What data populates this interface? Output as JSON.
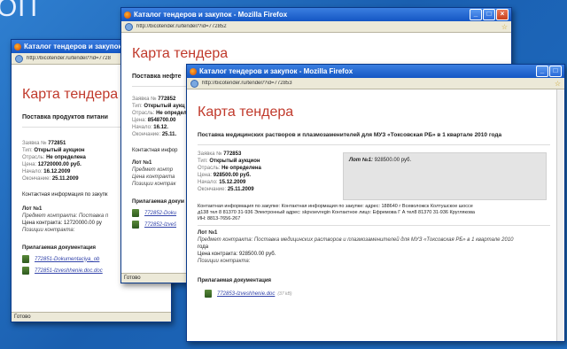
{
  "background_word": "ОП",
  "window_left": {
    "title": "Каталог тендеров и закупок - M",
    "url": "http://bicotender.ru/tender/?id=7728",
    "heading": "Карта тендера",
    "subject": "Поставка продуктов питани",
    "meta": {
      "request_label": "Заявка №",
      "request_value": "772851",
      "type_label": "Тип:",
      "type_value": "Открытый аукцион",
      "sector_label": "Отрасль:",
      "sector_value": "Не определена",
      "price_label": "Цена:",
      "price_value": "12720000.00 руб.",
      "start_label": "Начало:",
      "start_value": "16.12.2009",
      "end_label": "Окончание:",
      "end_value": "25.11.2009"
    },
    "contact": "Контактная информация по закупк",
    "lot_title": "Лот №1",
    "lot_subject": "Предмет контракта: Поставка п",
    "lot_price": "Цена контракта: 12720000.00 ру",
    "lot_positions": "Позиции контракта:",
    "docs_title": "Прилагаемая документация",
    "doc1": "772851-Dokumentaciya_ob",
    "doc2": "772851-Izveshhenie.doc.doc",
    "status": "Готово"
  },
  "window_mid": {
    "title": "Каталог тендеров и закупок - Mozilla Firefox",
    "url": "http://bicotender.ru/tender/?id=772852",
    "heading": "Карта тендера",
    "subject": "Поставка нефте",
    "meta": {
      "request_label": "Заявка №",
      "request_value": "772852",
      "type_label": "Тип:",
      "type_value": "Открытый аукц",
      "sector_label": "Отрасль:",
      "sector_value": "Не определ",
      "price_label": "Цена:",
      "price_value": "8548700.00",
      "start_label": "Начало:",
      "start_value": "16.12.",
      "end_label": "Окончание:",
      "end_value": "25.11."
    },
    "contact": "Контактная инфор",
    "lot_title": "Лот №1",
    "lot_subject": "Предмет контр",
    "lot_price": "Цена контракта",
    "lot_positions": "Позиции контрак",
    "docs_title": "Прилагаемая докум",
    "doc1": "772852-Doku",
    "doc2": "772852-Izveš",
    "status": "Готово"
  },
  "window_front": {
    "title": "Каталог тендеров и закупок - Mozilla Firefox",
    "url": "http://bicotender.ru/tender/?id=772853",
    "heading": "Карта тендера",
    "subject": "Поставка медицинских растворов и плазмозаменителей для МУЗ «Токсовская РБ» в 1 квартале 2010 года",
    "meta": {
      "request_label": "Заявка №",
      "request_value": "772853",
      "type_label": "Тип:",
      "type_value": "Открытый аукцион",
      "sector_label": "Отрасль:",
      "sector_value": "Не определена",
      "price_label": "Цена:",
      "price_value": "928500.00 руб.",
      "start_label": "Начало:",
      "start_value": "15.12.2009",
      "end_label": "Окончание:",
      "end_value": "25.11.2009"
    },
    "lotbox_label": "Лот №1:",
    "lotbox_value": "928500.00 руб.",
    "contact_line1": "Контактная информация по закупке: Контактная информация по закупке: адрес: 188640 г Всеволожск Колтушское шоссе",
    "contact_line2": "д138 тел 8 81370 31-936 Электронный адрес: skpvsevregin Контактное лицо: Ефремова Г А тел8 81370 31-936 Круглякова",
    "contact_line3": "ИН: 8813-7656-267",
    "lot_title": "Лот №1",
    "lot_subject": "Предмет контракта: Поставка медицинских растворов и плазмозаменителей для МУЗ «Токсовская РБ» в 1 квартале 2010",
    "lot_subject2": "года",
    "lot_price": "Цена контракта: 928500.00 руб.",
    "lot_positions": "Позиции контракта:",
    "docs_title": "Прилагаемая документация",
    "doc1": "772853-Izveshhenie.doc",
    "doc1_size": "(37 kB)"
  }
}
